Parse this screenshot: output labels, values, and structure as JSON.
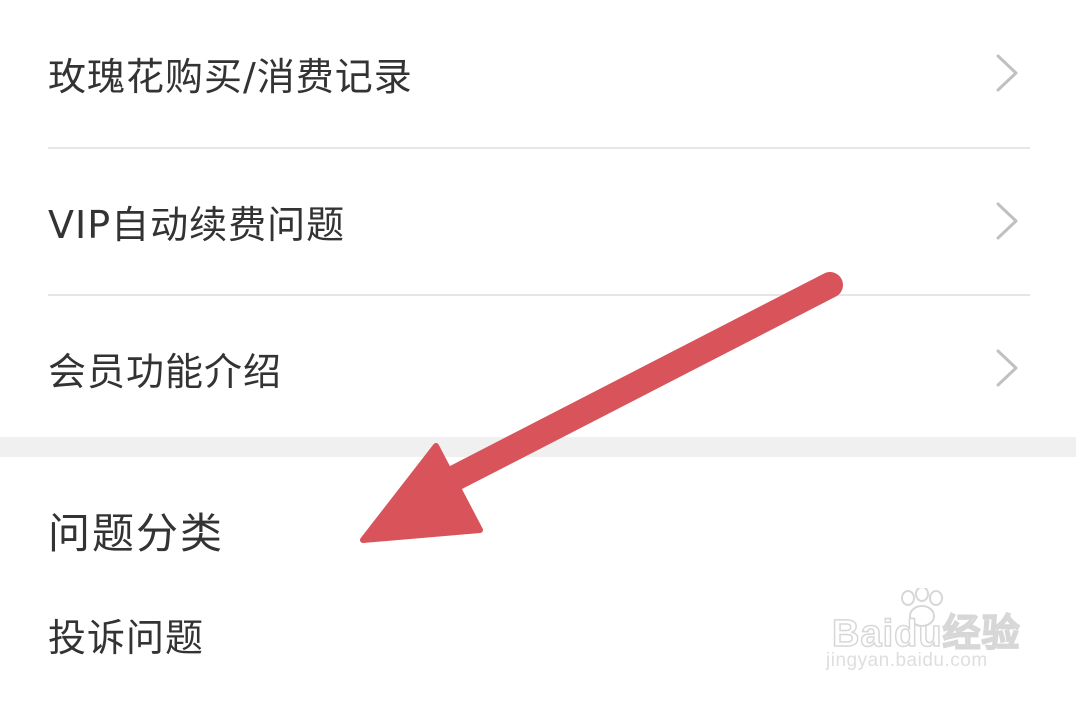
{
  "menu": {
    "items": [
      {
        "label": "玫瑰花购买/消费记录",
        "chevron": "chevron-right-icon"
      },
      {
        "label": "VIP自动续费问题",
        "chevron": "chevron-right-icon"
      },
      {
        "label": "会员功能介绍",
        "chevron": "chevron-right-icon"
      }
    ]
  },
  "section": {
    "title": "问题分类",
    "items": [
      {
        "label": "投诉问题"
      }
    ]
  },
  "watermark": {
    "brand": "Baidu经验",
    "url": "jingyan.baidu.com"
  },
  "colors": {
    "arrow": "#d9535b",
    "text": "#333333",
    "divider": "#e6e6e6",
    "section_gap": "#f0f0f0"
  }
}
